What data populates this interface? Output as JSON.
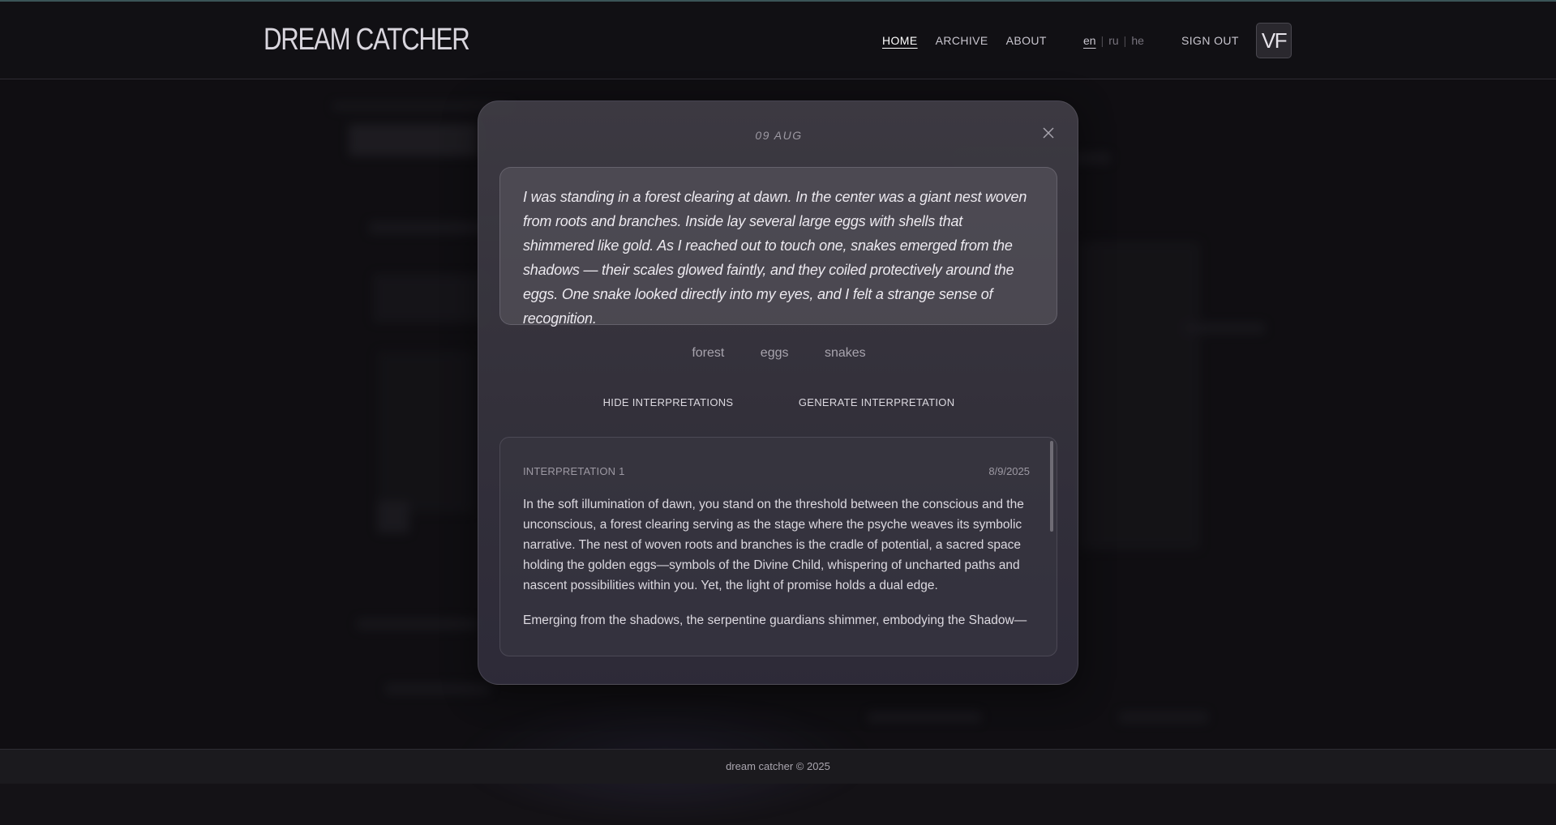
{
  "header": {
    "logo": "DREAM CATCHER",
    "nav": [
      {
        "label": "HOME",
        "active": true
      },
      {
        "label": "ARCHIVE",
        "active": false
      },
      {
        "label": "ABOUT",
        "active": false
      }
    ],
    "languages": [
      {
        "code": "en",
        "active": true
      },
      {
        "code": "ru",
        "active": false
      },
      {
        "code": "he",
        "active": false
      }
    ],
    "sign_out": "SIGN OUT",
    "avatar_initials": "VF"
  },
  "modal": {
    "date": "09 AUG",
    "close_icon": "close-icon",
    "dream_text": "I was standing in a forest clearing at dawn. In the center was a giant nest woven from roots and branches. Inside lay several large eggs with shells that shimmered like gold. As I reached out to touch one, snakes emerged from the shadows — their scales glowed faintly, and they coiled protectively around the eggs. One snake looked directly into my eyes, and I felt a strange sense of recognition.",
    "tags": [
      "forest",
      "eggs",
      "snakes"
    ],
    "hide_interpretations_label": "HIDE INTERPRETATIONS",
    "generate_interpretation_label": "GENERATE INTERPRETATION",
    "interpretation": {
      "title": "INTERPRETATION 1",
      "date": "8/9/2025",
      "paragraphs": [
        "In the soft illumination of dawn, you stand on the threshold between the conscious and the unconscious, a forest clearing serving as the stage where the psyche weaves its symbolic narrative. The nest of woven roots and branches is the cradle of potential, a sacred space holding the golden eggs—symbols of the Divine Child, whispering of uncharted paths and nascent possibilities within you. Yet, the light of promise holds a dual edge.",
        "Emerging from the shadows, the serpentine guardians shimmer, embodying the Shadow—"
      ]
    }
  },
  "footer": {
    "text": "dream catcher © 2025"
  },
  "colors": {
    "background": "#141216",
    "header_border_accent": "#3b5558",
    "modal_background": "#413f47",
    "text_primary": "#e6e3ea"
  }
}
